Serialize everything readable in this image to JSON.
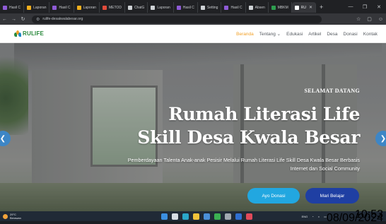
{
  "browser": {
    "tabs": [
      {
        "label": "Hasil C",
        "favicon_color": "#8e5bd6",
        "active": false
      },
      {
        "label": "Laporan",
        "favicon_color": "#f2b01e",
        "active": false
      },
      {
        "label": "Hasil C",
        "favicon_color": "#8e5bd6",
        "active": false
      },
      {
        "label": "Laporan",
        "favicon_color": "#f2b01e",
        "active": false
      },
      {
        "label": "METOD",
        "favicon_color": "#e24b3b",
        "active": false
      },
      {
        "label": "ChatG",
        "favicon_color": "#cfd3d6",
        "active": false
      },
      {
        "label": "Laporan",
        "favicon_color": "#cfd3d6",
        "active": false
      },
      {
        "label": "Hasil C",
        "favicon_color": "#8e5bd6",
        "active": false
      },
      {
        "label": "Setting",
        "favicon_color": "#cfd3d6",
        "active": false
      },
      {
        "label": "Hasil C",
        "favicon_color": "#8e5bd6",
        "active": false
      },
      {
        "label": "Absen",
        "favicon_color": "#cfd3d6",
        "active": false
      },
      {
        "label": "MBKM",
        "favicon_color": "#2e9e4f",
        "active": false
      },
      {
        "label": "RU",
        "favicon_color": "#ffffff",
        "active": true
      }
    ],
    "new_tab_icon": "plus-icon",
    "url": "rulife-desakwalabesar.org",
    "window_controls": [
      "minimize-icon",
      "restore-icon",
      "close-icon"
    ]
  },
  "site": {
    "logo_text": "RULIFE",
    "logo_colors": [
      "#2b8a3e",
      "#f2a027",
      "#1e88c7"
    ],
    "nav": [
      {
        "label": "Beranda",
        "active": true
      },
      {
        "label": "Tentang ⌄",
        "active": false
      },
      {
        "label": "Edukasi",
        "active": false
      },
      {
        "label": "Artikel",
        "active": false
      },
      {
        "label": "Desa",
        "active": false
      },
      {
        "label": "Donasi",
        "active": false
      },
      {
        "label": "Kontak",
        "active": false
      }
    ],
    "accent_color": "#f2a027"
  },
  "hero": {
    "welcome": "SELAMAT DATANG",
    "title_line1": "Rumah Literasi Life",
    "title_line2": "Skill Desa Kwala Besar",
    "subtitle": "Pemberdayaan Talenta Anak-anak Pesisir Melalui Rumah Literasi Life Skill Desa Kwala Besar Berbasis Internet dan Social Community",
    "btn_donasi": "Ayo Donasi",
    "btn_belajar": "Mari Belajar",
    "btn_donasi_color": "#22a7e0",
    "btn_belajar_color": "#1f3fa3"
  },
  "taskbar": {
    "weather_temp": "29°C",
    "weather_desc": "Berawan",
    "apps": [
      {
        "icon": "windows-start-icon",
        "color": "#3b8fe0"
      },
      {
        "icon": "search-icon",
        "color": "#d7dde4"
      },
      {
        "icon": "browser-edge-icon",
        "color": "#2aa7c9"
      },
      {
        "icon": "file-explorer-icon",
        "color": "#f0c23a"
      },
      {
        "icon": "store-icon",
        "color": "#4a8fd8"
      },
      {
        "icon": "chrome-icon",
        "color": "#3bb052"
      },
      {
        "icon": "settings-icon",
        "color": "#a0a8b0"
      },
      {
        "icon": "word-icon",
        "color": "#2f6fd1"
      },
      {
        "icon": "photos-icon",
        "color": "#e04a5a"
      }
    ],
    "lang": "ENG",
    "time": "10:53",
    "date": "08/09/2024"
  }
}
